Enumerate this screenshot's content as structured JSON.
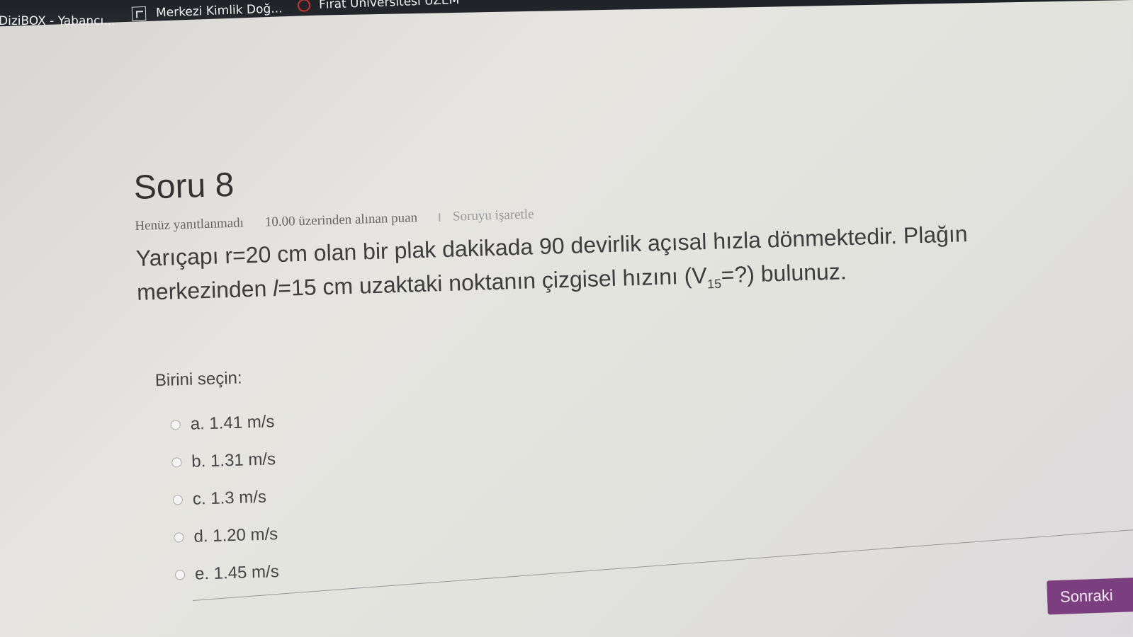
{
  "bookmarks": [
    {
      "label": "DiziBOX - Yabancı..."
    },
    {
      "label": "Merkezi Kimlik Doğ..."
    },
    {
      "label": "Fırat Üniversitesi ÜZEM"
    }
  ],
  "question": {
    "title": "Soru 8",
    "status": "Henüz yanıtlanmadı",
    "points": "10.00 üzerinden alınan puan",
    "flag_label": "Soruyu işaretle",
    "text_part1": "Yarıçapı r=20 cm olan bir plak dakikada 90 devirlik açısal hızla dönmektedir. Plağın merkezinden ",
    "l_symbol": "l",
    "text_part2": "=15 cm  uzaktaki noktanın çizgisel hızını (V",
    "subscript": "15",
    "text_part3": "=?) bulunuz."
  },
  "choose_label": "Birini seçin:",
  "options": [
    {
      "label": "a. 1.41 m/s"
    },
    {
      "label": "b. 1.31 m/s"
    },
    {
      "label": "c. 1.3 m/s"
    },
    {
      "label": "d. 1.20 m/s"
    },
    {
      "label": "e. 1.45 m/s"
    }
  ],
  "next_button": "Sonraki"
}
